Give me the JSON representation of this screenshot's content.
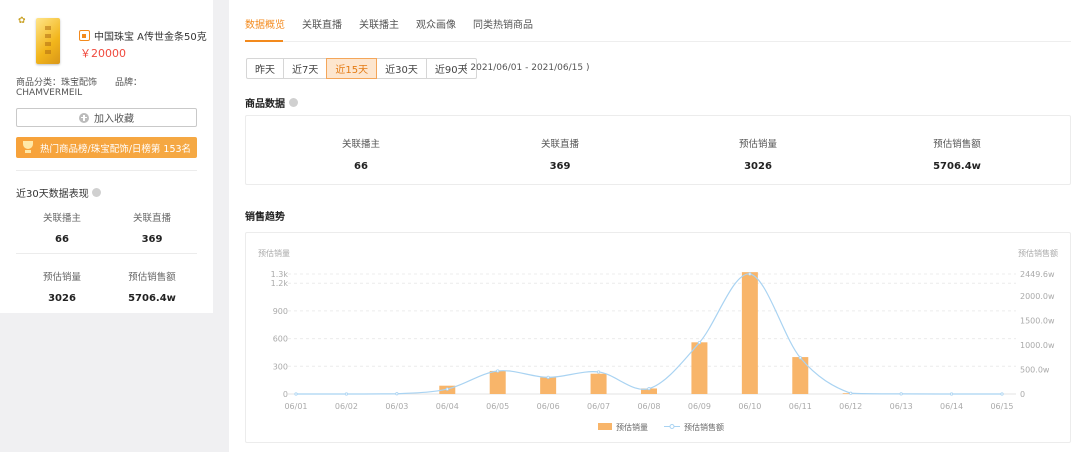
{
  "product": {
    "title": "中国珠宝 A传世金条50克",
    "price": "￥20000",
    "category_label": "商品分类：",
    "category_value": "珠宝配饰",
    "brand_label": "品牌：",
    "brand_value": "CHAMVERMEIL",
    "fav_button": "加入收藏",
    "rank_banner": "热门商品榜/珠宝配饰/日榜第 153名"
  },
  "left_stats": {
    "title": "近30天数据表现",
    "items": [
      {
        "label": "关联播主",
        "value": "66"
      },
      {
        "label": "关联直播",
        "value": "369"
      },
      {
        "label": "预估销量",
        "value": "3026"
      },
      {
        "label": "预估销售额",
        "value": "5706.4w"
      }
    ]
  },
  "tabs": [
    {
      "label": "数据概览",
      "active": true
    },
    {
      "label": "关联直播",
      "active": false
    },
    {
      "label": "关联播主",
      "active": false
    },
    {
      "label": "观众画像",
      "active": false
    },
    {
      "label": "同类热销商品",
      "active": false
    }
  ],
  "date_filter": {
    "options": [
      "昨天",
      "近7天",
      "近15天",
      "近30天",
      "近90天"
    ],
    "selected": "近15天",
    "range_text": "( 2021/06/01 - 2021/06/15 )"
  },
  "product_data": {
    "title": "商品数据",
    "metrics": [
      {
        "label": "关联播主",
        "value": "66"
      },
      {
        "label": "关联直播",
        "value": "369"
      },
      {
        "label": "预估销量",
        "value": "3026"
      },
      {
        "label": "预估销售额",
        "value": "5706.4w"
      }
    ]
  },
  "sales_trend": {
    "title": "销售趋势"
  },
  "chart_data": {
    "type": "bar",
    "title": "",
    "categories": [
      "06/01",
      "06/02",
      "06/03",
      "06/04",
      "06/05",
      "06/06",
      "06/07",
      "06/08",
      "06/09",
      "06/10",
      "06/11",
      "06/12",
      "06/13",
      "06/14",
      "06/15"
    ],
    "series": [
      {
        "name": "预估销量",
        "type": "bar",
        "axis": "left",
        "color": "#f8b56a",
        "values": [
          0,
          0,
          0,
          90,
          250,
          180,
          220,
          60,
          560,
          1320,
          400,
          8,
          0,
          0,
          0
        ]
      },
      {
        "name": "预估销售额",
        "type": "line",
        "axis": "right",
        "color": "#a9d3f2",
        "values": [
          0,
          0,
          5,
          100,
          470,
          340,
          450,
          110,
          1050,
          2449.6,
          740,
          15,
          2,
          0,
          0
        ]
      }
    ],
    "ylabel_left": "预估销量",
    "ylabel_right": "预估销售额",
    "yticks_left": [
      "0",
      "300",
      "600",
      "900",
      "1.2k",
      "1.3k"
    ],
    "yticks_left_values": [
      0,
      300,
      600,
      900,
      1200,
      1300
    ],
    "ylim_left": [
      0,
      1300
    ],
    "yticks_right": [
      "0",
      "500.0w",
      "1000.0w",
      "1500.0w",
      "2000.0w",
      "2449.6w"
    ],
    "yticks_right_values": [
      0,
      500,
      1000,
      1500,
      2000,
      2449.6
    ],
    "ylim_right": [
      0,
      2449.6
    ],
    "grid": true,
    "legend": "bottom-center"
  }
}
